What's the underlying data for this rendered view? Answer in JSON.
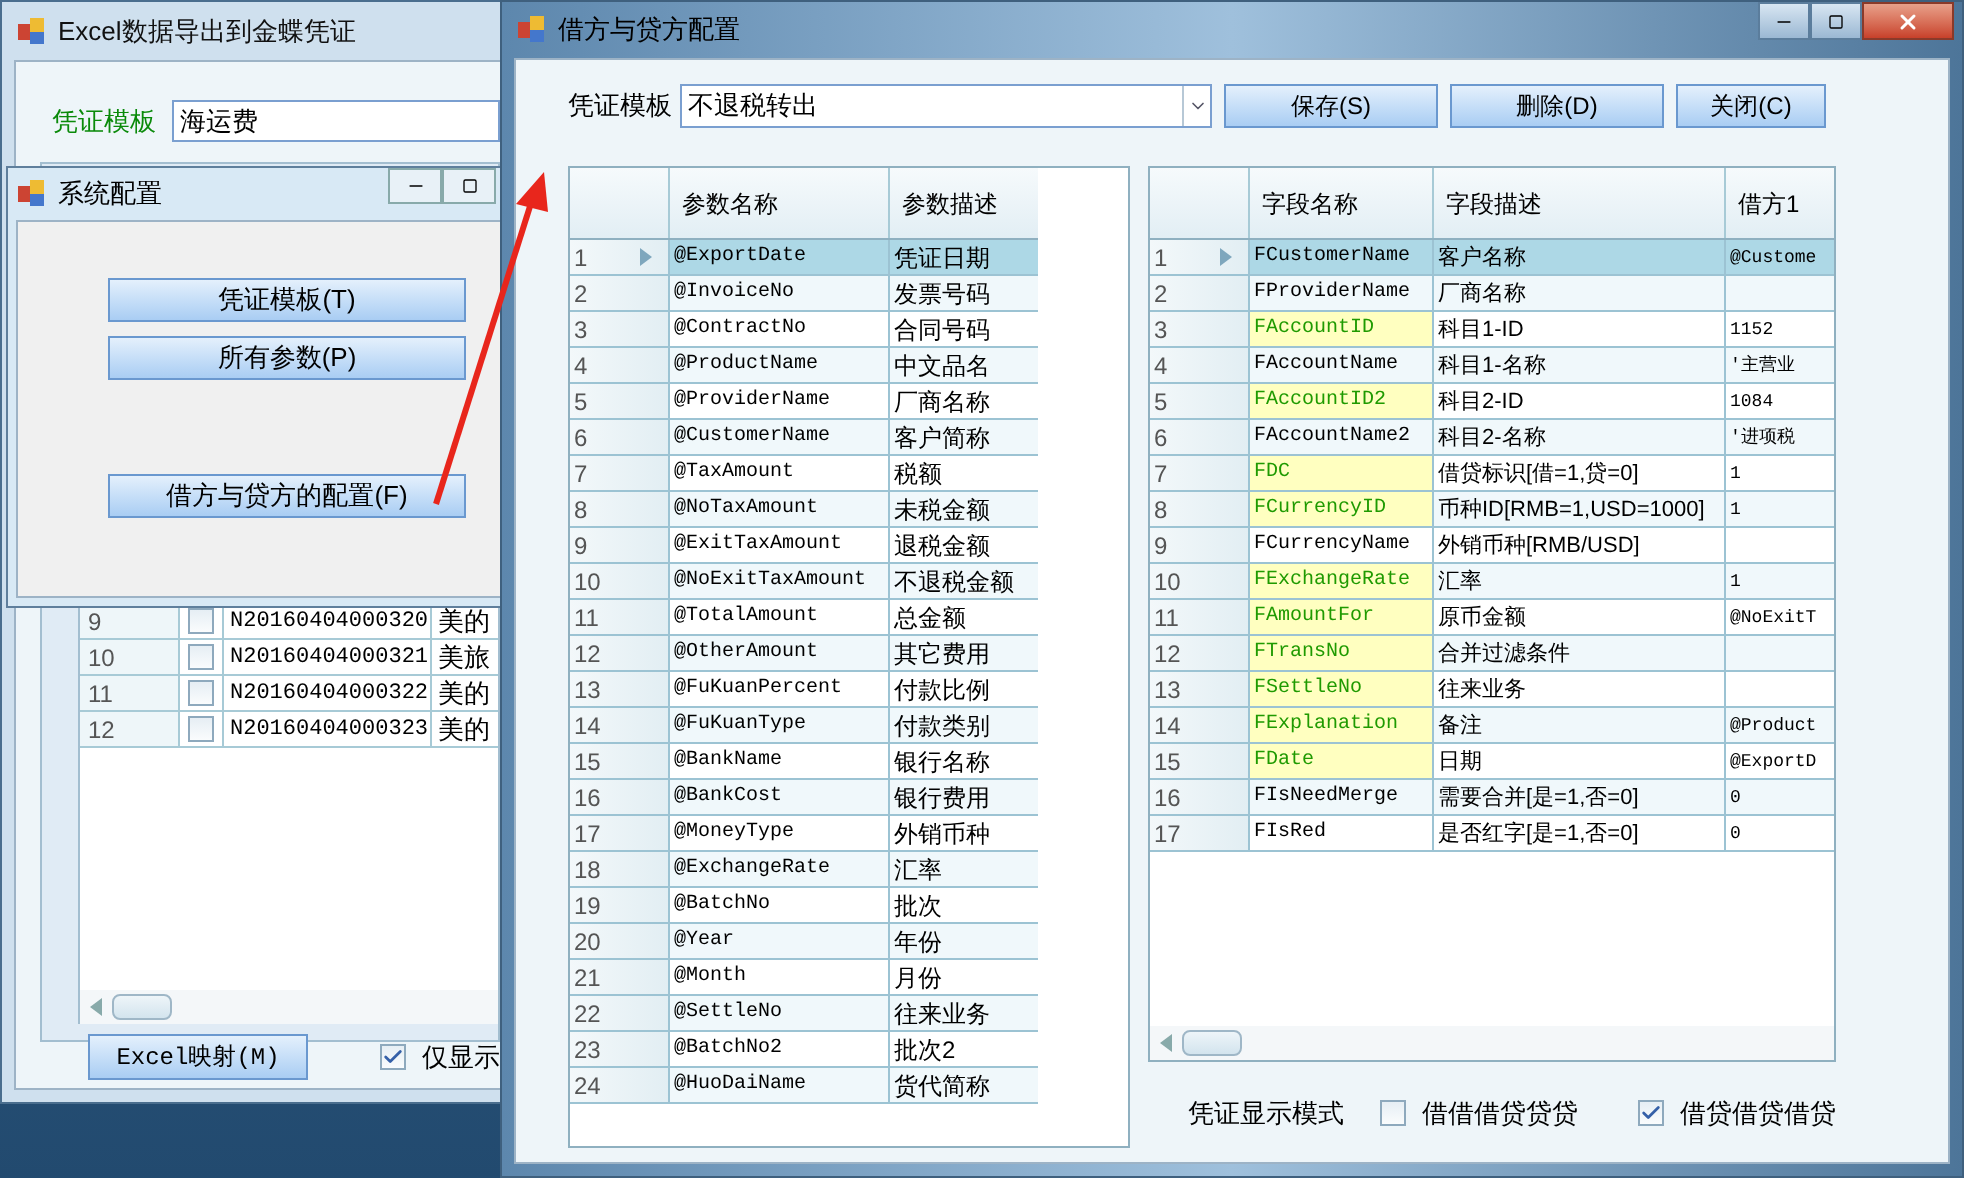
{
  "back_window": {
    "title": "Excel数据导出到金蝶凭证",
    "template_label": "凭证模板",
    "template_value": "海运费",
    "rows": [
      {
        "no": "9",
        "checked": false,
        "code": "N20160404000320",
        "name": "美的"
      },
      {
        "no": "10",
        "checked": false,
        "code": "N20160404000321",
        "name": "美旅"
      },
      {
        "no": "11",
        "checked": false,
        "code": "N20160404000322",
        "name": "美的"
      },
      {
        "no": "12",
        "checked": false,
        "code": "N20160404000323",
        "name": "美的"
      }
    ],
    "excel_button": "Excel映射(M)",
    "only_show": {
      "label": "仅显示",
      "checked": true
    }
  },
  "system_config": {
    "title": "系统配置",
    "buttons": [
      "凭证模板(T)",
      "所有参数(P)",
      "借方与贷方的配置(F)"
    ]
  },
  "main_window": {
    "title": "借方与贷方配置",
    "template_label": "凭证模板",
    "template_value": "不退税转出",
    "buttons": [
      "保存(S)",
      "删除(D)",
      "关闭(C)"
    ],
    "params_table": {
      "columns": [
        "参数名称",
        "参数描述"
      ],
      "rows": [
        {
          "no": "1",
          "name": "@ExportDate",
          "desc": "凭证日期",
          "selected": true
        },
        {
          "no": "2",
          "name": "@InvoiceNo",
          "desc": "发票号码",
          "selected": false
        },
        {
          "no": "3",
          "name": "@ContractNo",
          "desc": "合同号码",
          "selected": false
        },
        {
          "no": "4",
          "name": "@ProductName",
          "desc": "中文品名",
          "selected": false
        },
        {
          "no": "5",
          "name": "@ProviderName",
          "desc": "厂商名称",
          "selected": false
        },
        {
          "no": "6",
          "name": "@CustomerName",
          "desc": "客户简称",
          "selected": false
        },
        {
          "no": "7",
          "name": "@TaxAmount",
          "desc": "税额",
          "selected": false
        },
        {
          "no": "8",
          "name": "@NoTaxAmount",
          "desc": "未税金额",
          "selected": false
        },
        {
          "no": "9",
          "name": "@ExitTaxAmount",
          "desc": "退税金额",
          "selected": false
        },
        {
          "no": "10",
          "name": "@NoExitTaxAmount",
          "desc": "不退税金额",
          "selected": false
        },
        {
          "no": "11",
          "name": "@TotalAmount",
          "desc": "总金额",
          "selected": false
        },
        {
          "no": "12",
          "name": "@OtherAmount",
          "desc": "其它费用",
          "selected": false
        },
        {
          "no": "13",
          "name": "@FuKuanPercent",
          "desc": "付款比例",
          "selected": false
        },
        {
          "no": "14",
          "name": "@FuKuanType",
          "desc": "付款类别",
          "selected": false
        },
        {
          "no": "15",
          "name": "@BankName",
          "desc": "银行名称",
          "selected": false
        },
        {
          "no": "16",
          "name": "@BankCost",
          "desc": "银行费用",
          "selected": false
        },
        {
          "no": "17",
          "name": "@MoneyType",
          "desc": "外销币种",
          "selected": false
        },
        {
          "no": "18",
          "name": "@ExchangeRate",
          "desc": "汇率",
          "selected": false
        },
        {
          "no": "19",
          "name": "@BatchNo",
          "desc": "批次",
          "selected": false
        },
        {
          "no": "20",
          "name": "@Year",
          "desc": "年份",
          "selected": false
        },
        {
          "no": "21",
          "name": "@Month",
          "desc": "月份",
          "selected": false
        },
        {
          "no": "22",
          "name": "@SettleNo",
          "desc": "往来业务",
          "selected": false
        },
        {
          "no": "23",
          "name": "@BatchNo2",
          "desc": "批次2",
          "selected": false
        },
        {
          "no": "24",
          "name": "@HuoDaiName",
          "desc": "货代简称",
          "selected": false
        }
      ]
    },
    "fields_table": {
      "columns": [
        "字段名称",
        "字段描述",
        "借方1"
      ],
      "rows": [
        {
          "no": "1",
          "name": "FCustomerName",
          "desc": "客户名称",
          "debit": "@Custome",
          "required": false,
          "selected": true
        },
        {
          "no": "2",
          "name": "FProviderName",
          "desc": "厂商名称",
          "debit": "",
          "required": false,
          "selected": false
        },
        {
          "no": "3",
          "name": "FAccountID",
          "desc": "科目1-ID",
          "debit": "1152",
          "required": true,
          "selected": false
        },
        {
          "no": "4",
          "name": "FAccountName",
          "desc": "科目1-名称",
          "debit": "'主营业",
          "required": false,
          "selected": false
        },
        {
          "no": "5",
          "name": "FAccountID2",
          "desc": "科目2-ID",
          "debit": "1084",
          "required": true,
          "selected": false
        },
        {
          "no": "6",
          "name": "FAccountName2",
          "desc": "科目2-名称",
          "debit": "'进项税",
          "required": false,
          "selected": false
        },
        {
          "no": "7",
          "name": "FDC",
          "desc": "借贷标识[借=1,贷=0]",
          "debit": "1",
          "required": true,
          "selected": false
        },
        {
          "no": "8",
          "name": "FCurrencyID",
          "desc": "币种ID[RMB=1,USD=1000]",
          "debit": "1",
          "required": true,
          "selected": false
        },
        {
          "no": "9",
          "name": "FCurrencyName",
          "desc": "外销币种[RMB/USD]",
          "debit": "",
          "required": false,
          "selected": false
        },
        {
          "no": "10",
          "name": "FExchangeRate",
          "desc": "汇率",
          "debit": "1",
          "required": true,
          "selected": false
        },
        {
          "no": "11",
          "name": "FAmountFor",
          "desc": "原币金额",
          "debit": "@NoExitT",
          "required": true,
          "selected": false
        },
        {
          "no": "12",
          "name": "FTransNo",
          "desc": "合并过滤条件",
          "debit": "",
          "required": true,
          "selected": false
        },
        {
          "no": "13",
          "name": "FSettleNo",
          "desc": "往来业务",
          "debit": "",
          "required": true,
          "selected": false
        },
        {
          "no": "14",
          "name": "FExplanation",
          "desc": "备注",
          "debit": "@Product",
          "required": true,
          "selected": false
        },
        {
          "no": "15",
          "name": "FDate",
          "desc": "日期",
          "debit": "@ExportD",
          "required": true,
          "selected": false
        },
        {
          "no": "16",
          "name": "FIsNeedMerge",
          "desc": "需要合并[是=1,否=0]",
          "debit": "0",
          "required": false,
          "selected": false
        },
        {
          "no": "17",
          "name": "FIsRed",
          "desc": "是否红字[是=1,否=0]",
          "debit": "0",
          "required": false,
          "selected": false
        }
      ]
    },
    "display_mode": {
      "label": "凭证显示模式",
      "options": [
        {
          "label": "借借借贷贷贷",
          "checked": false
        },
        {
          "label": "借贷借贷借贷",
          "checked": true
        }
      ]
    }
  }
}
